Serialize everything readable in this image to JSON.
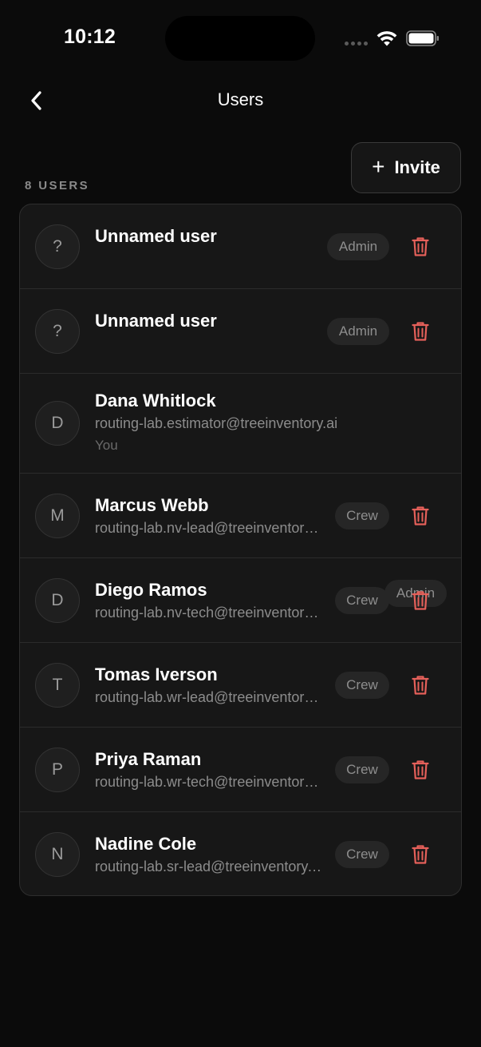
{
  "status_bar": {
    "time": "10:12"
  },
  "nav": {
    "title": "Users"
  },
  "actions": {
    "invite_plus": "+",
    "invite_label": "Invite"
  },
  "list": {
    "count_label": "8 USERS",
    "users": [
      {
        "initial": "?",
        "name": "Unnamed user",
        "email": "",
        "note": "",
        "role": "Admin",
        "deletable": true
      },
      {
        "initial": "?",
        "name": "Unnamed user",
        "email": "",
        "note": "",
        "role": "Admin",
        "deletable": true
      },
      {
        "initial": "D",
        "name": "Dana Whitlock",
        "email": "routing-lab.estimator@treeinventory.ai",
        "note": "You",
        "role": "Admin",
        "deletable": false
      },
      {
        "initial": "M",
        "name": "Marcus Webb",
        "email": "routing-lab.nv-lead@treeinventory.ai",
        "note": "",
        "role": "Crew",
        "deletable": true
      },
      {
        "initial": "D",
        "name": "Diego Ramos",
        "email": "routing-lab.nv-tech@treeinventory.ai",
        "note": "",
        "role": "Crew",
        "deletable": true
      },
      {
        "initial": "T",
        "name": "Tomas Iverson",
        "email": "routing-lab.wr-lead@treeinventory.ai",
        "note": "",
        "role": "Crew",
        "deletable": true
      },
      {
        "initial": "P",
        "name": "Priya Raman",
        "email": "routing-lab.wr-tech@treeinventory.ai",
        "note": "",
        "role": "Crew",
        "deletable": true
      },
      {
        "initial": "N",
        "name": "Nadine Cole",
        "email": "routing-lab.sr-lead@treeinventory.ai",
        "note": "",
        "role": "Crew",
        "deletable": true
      }
    ]
  },
  "colors": {
    "background": "#0b0b0b",
    "card": "#171717",
    "delete_accent": "#e5605a",
    "badge_bg": "#262626",
    "muted_text": "#8c8c8c"
  },
  "icons": {
    "back": "chevron-left-icon",
    "wifi": "wifi-icon",
    "battery": "battery-icon",
    "delete": "trash-icon"
  }
}
